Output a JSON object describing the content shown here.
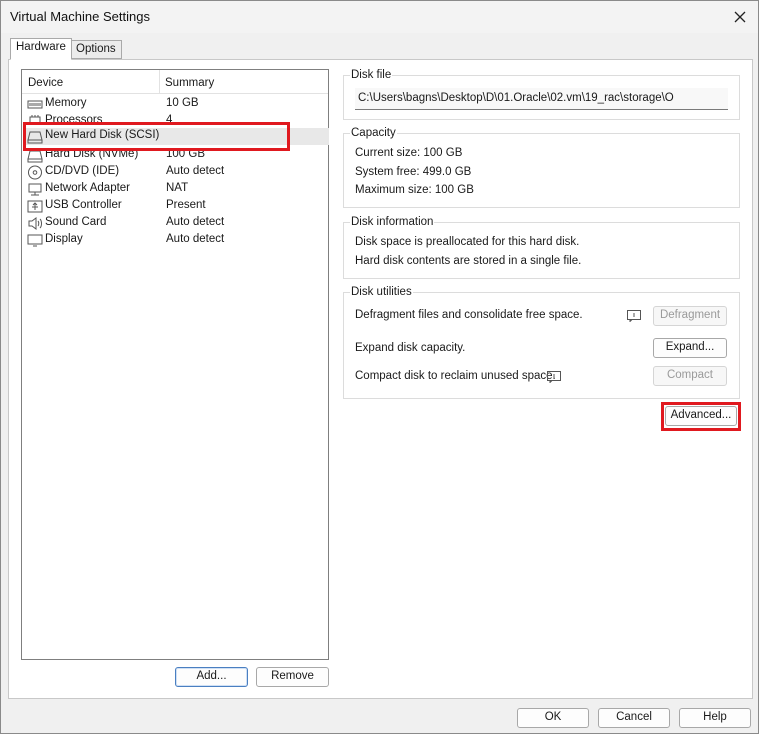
{
  "window": {
    "title": "Virtual Machine Settings"
  },
  "tabs": [
    {
      "label": "Hardware"
    },
    {
      "label": "Options"
    }
  ],
  "device_list": {
    "headers": {
      "device": "Device",
      "summary": "Summary"
    },
    "rows": [
      {
        "device": "Memory",
        "summary": "10 GB",
        "icon": "memory-icon"
      },
      {
        "device": "Processors",
        "summary": "4",
        "icon": "processor-icon"
      },
      {
        "device": "New Hard Disk (SCSI)",
        "summary": "",
        "icon": "hard-disk-icon"
      },
      {
        "device": "Hard Disk (NVMe)",
        "summary": "100 GB",
        "icon": "hard-disk-icon"
      },
      {
        "device": "CD/DVD (IDE)",
        "summary": "Auto detect",
        "icon": "cd-dvd-icon"
      },
      {
        "device": "Network Adapter",
        "summary": "NAT",
        "icon": "network-icon"
      },
      {
        "device": "USB Controller",
        "summary": "Present",
        "icon": "usb-icon"
      },
      {
        "device": "Sound Card",
        "summary": "Auto detect",
        "icon": "speaker-icon"
      },
      {
        "device": "Display",
        "summary": "Auto detect",
        "icon": "monitor-icon"
      }
    ],
    "add_label": "Add...",
    "remove_label": "Remove"
  },
  "disk_file": {
    "heading": "Disk file",
    "path": "C:\\Users\\bagns\\Desktop\\D\\01.Oracle\\02.vm\\19_rac\\storage\\O"
  },
  "capacity": {
    "heading": "Capacity",
    "current_size": "Current size:  100 GB",
    "system_free": "System free:  499.0 GB",
    "maximum_size": "Maximum size:  100 GB"
  },
  "disk_information": {
    "heading": "Disk information",
    "line1": "Disk space is preallocated for this hard disk.",
    "line2": "Hard disk contents are stored in a single file."
  },
  "disk_utilities": {
    "heading": "Disk utilities",
    "defragment_text": "Defragment files and consolidate free space.",
    "defragment_label": "Defragment",
    "expand_text": "Expand disk capacity.",
    "expand_label": "Expand...",
    "compact_text": "Compact disk to reclaim unused space.",
    "compact_label": "Compact"
  },
  "advanced_label": "Advanced...",
  "footer": {
    "ok_label": "OK",
    "cancel_label": "Cancel",
    "help_label": "Help"
  },
  "colors": {
    "highlight": "#e0191f",
    "default_button_border": "#4a7fc1"
  }
}
